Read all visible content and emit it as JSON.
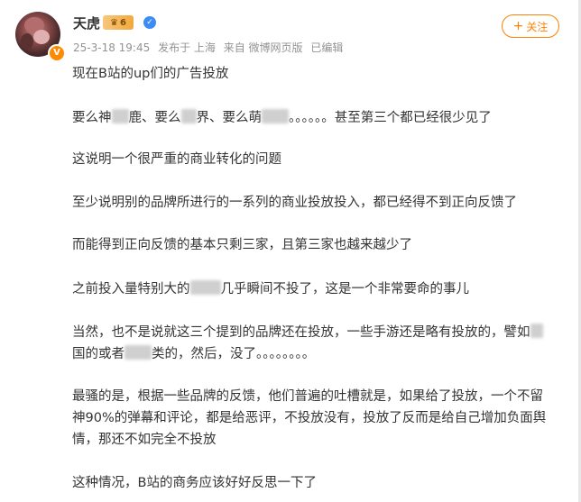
{
  "post": {
    "username": "天虎",
    "vip_level": "6",
    "crown_text": "♛",
    "verify_symbol": "✓",
    "avatar_badge": "V",
    "date": "25-3-18 19:45",
    "location": "发布于 上海",
    "source": "来自 微博网页版",
    "edited": "已编辑",
    "follow_label": "关注",
    "follow_plus": "+",
    "paragraphs": {
      "p1": "现在B站的up们的广告投放",
      "p2a": "要么神",
      "p2b": "鹿、要么",
      "p2c": "界、要么萌",
      "p2d": "。。。。。。甚至第三个都已经很少见了",
      "p3": "这说明一个很严重的商业转化的问题",
      "p4": "至少说明别的品牌所进行的一系列的商业投放投入，都已经得不到正向反馈了",
      "p5": "而能得到正向反馈的基本只剩三家，且第三家也越来越少了",
      "p6a": "之前投入量特别大的",
      "p6b": "几乎瞬间不投了，这是一个非常要命的事儿",
      "p7a": "当然，也不是说就这三个提到的品牌还在投放，一些手游还是略有投放的，譬如",
      "p7b": "国的或者",
      "p7c": "类的，然后，没了。。。。。。。。",
      "p8a": "最骚的是，根据一些品牌的反馈，他们普遍的吐槽就是，如果给了投放，一个不留",
      "p8b": "神90%的弹幕和评论，都是给恶评，不投放没有，投放了反而是给自己增加负面舆",
      "p8c": "情，那还不如完全不投放",
      "p9": "这种情况，B站的商务应该好好反思一下了"
    }
  }
}
